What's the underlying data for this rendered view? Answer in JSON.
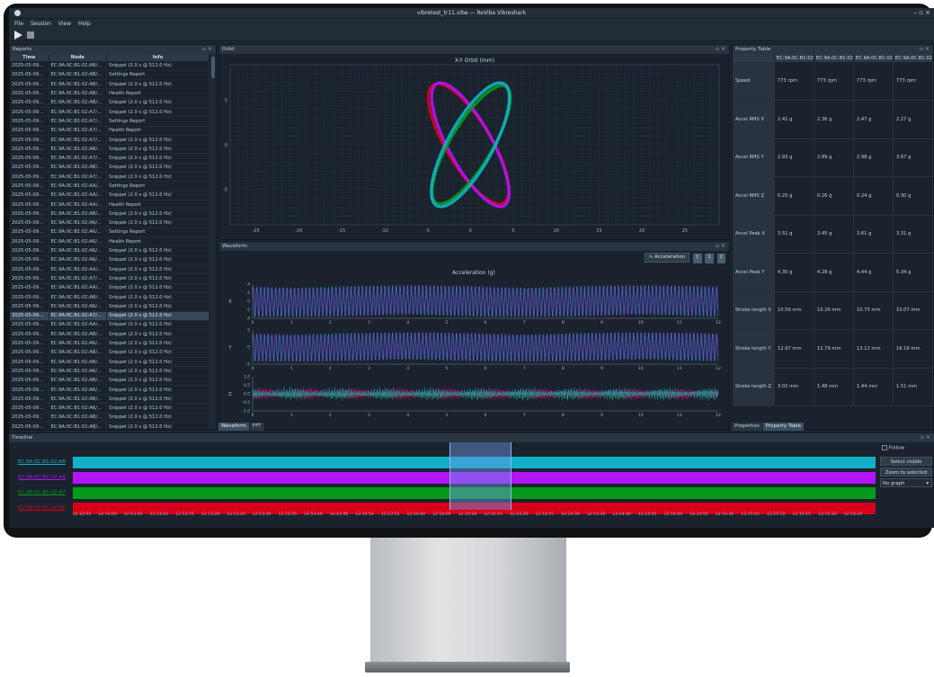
{
  "window": {
    "title": "vibretest_tr11.vibe — ReVibe Vibreshark",
    "controls": "– ▫ ×"
  },
  "menu": [
    "File",
    "Session",
    "View",
    "Help"
  ],
  "panels": {
    "reports": "Reports",
    "orbit": "Orbit",
    "waveform": "Waveform",
    "property_table": "Property Table",
    "timeline": "Timeline",
    "float_close": "▫ ×"
  },
  "reports": {
    "columns": [
      "Time",
      "Node",
      "Info"
    ],
    "rows": [
      [
        "2025-05-09...",
        "EC:9A:0C:B1:02:AB/...",
        "Snippet (2.0 s @ 512.0 Hz)"
      ],
      [
        "2025-05-09...",
        "EC:9A:0C:B1:02:AB/...",
        "Settings Report"
      ],
      [
        "2025-05-09...",
        "EC:9A:0C:B1:02:AB/...",
        "Snippet (2.0 s @ 512.0 Hz)"
      ],
      [
        "2025-05-09...",
        "EC:9A:0C:B1:02:AB/...",
        "Health Report"
      ],
      [
        "2025-05-09...",
        "EC:9A:0C:B1:02:AB/...",
        "Snippet (2.0 s @ 512.0 Hz)"
      ],
      [
        "2025-05-09...",
        "EC:9A:0C:B1:02:A7/...",
        "Snippet (2.0 s @ 512.0 Hz)"
      ],
      [
        "2025-05-09...",
        "EC:9A:0C:B1:02:A7/...",
        "Settings Report"
      ],
      [
        "2025-05-09...",
        "EC:9A:0C:B1:02:A7/...",
        "Health Report"
      ],
      [
        "2025-05-09...",
        "EC:9A:0C:B1:02:A7/...",
        "Snippet (2.0 s @ 512.0 Hz)"
      ],
      [
        "2025-05-09...",
        "EC:9A:0C:B1:02:AB/...",
        "Snippet (2.0 s @ 512.0 Hz)"
      ],
      [
        "2025-05-09...",
        "EC:9A:0C:B1:02:A7/...",
        "Snippet (2.0 s @ 512.0 Hz)"
      ],
      [
        "2025-05-09...",
        "EC:9A:0C:B1:02:AB/...",
        "Snippet (2.0 s @ 512.0 Hz)"
      ],
      [
        "2025-05-09...",
        "EC:9A:0C:B1:02:A7/...",
        "Snippet (2.0 s @ 512.0 Hz)"
      ],
      [
        "2025-05-09...",
        "EC:9A:0C:B1:02:AA/...",
        "Settings Report"
      ],
      [
        "2025-05-09...",
        "EC:9A:0C:B1:02:AA/...",
        "Snippet (2.0 s @ 512.0 Hz)"
      ],
      [
        "2025-05-09...",
        "EC:9A:0C:B1:02:AA/...",
        "Health Report"
      ],
      [
        "2025-05-09...",
        "EC:9A:0C:B1:02:AB/...",
        "Snippet (2.0 s @ 512.0 Hz)"
      ],
      [
        "2025-05-09...",
        "EC:9A:0C:B1:02:A6/...",
        "Snippet (2.0 s @ 512.0 Hz)"
      ],
      [
        "2025-05-09...",
        "EC:9A:0C:B1:02:A6/...",
        "Settings Report"
      ],
      [
        "2025-05-09...",
        "EC:9A:0C:B1:02:A6/...",
        "Health Report"
      ],
      [
        "2025-05-09...",
        "EC:9A:0C:B1:02:A6/...",
        "Snippet (2.0 s @ 512.0 Hz)"
      ],
      [
        "2025-05-09...",
        "EC:9A:0C:B1:02:A6/...",
        "Snippet (2.0 s @ 512.0 Hz)"
      ],
      [
        "2025-05-09...",
        "EC:9A:0C:B1:02:AA/...",
        "Snippet (2.0 s @ 512.0 Hz)"
      ],
      [
        "2025-05-09...",
        "EC:9A:0C:B1:02:A7/...",
        "Snippet (2.0 s @ 512.0 Hz)"
      ],
      [
        "2025-05-09...",
        "EC:9A:0C:B1:02:AA/...",
        "Snippet (2.0 s @ 512.0 Hz)"
      ],
      [
        "2025-05-09...",
        "EC:9A:0C:B1:02:AB/...",
        "Snippet (2.0 s @ 512.0 Hz)"
      ],
      [
        "2025-05-09...",
        "EC:9A:0C:B1:02:A6/...",
        "Snippet (2.0 s @ 512.0 Hz)"
      ],
      [
        "2025-05-09...",
        "EC:9A:0C:B1:02:A7/...",
        "Snippet (2.0 s @ 512.0 Hz)"
      ],
      [
        "2025-05-09...",
        "EC:9A:0C:B1:02:AA/...",
        "Snippet (2.0 s @ 512.0 Hz)"
      ],
      [
        "2025-05-09...",
        "EC:9A:0C:B1:02:AB/...",
        "Snippet (2.0 s @ 512.0 Hz)"
      ],
      [
        "2025-05-09...",
        "EC:9A:0C:B1:02:A6/...",
        "Snippet (2.0 s @ 512.0 Hz)"
      ],
      [
        "2025-05-09...",
        "EC:9A:0C:B1:02:AB/...",
        "Snippet (2.0 s @ 512.0 Hz)"
      ],
      [
        "2025-05-09...",
        "EC:9A:0C:B1:02:AB/...",
        "Snippet (2.0 s @ 512.0 Hz)"
      ],
      [
        "2025-05-09...",
        "EC:9A:0C:B1:02:A6/...",
        "Snippet (2.0 s @ 512.0 Hz)"
      ],
      [
        "2025-05-09...",
        "EC:9A:0C:B1:02:AB/...",
        "Snippet (2.0 s @ 512.0 Hz)"
      ],
      [
        "2025-05-09...",
        "EC:9A:0C:B1:02:A6/...",
        "Snippet (2.0 s @ 512.0 Hz)"
      ],
      [
        "2025-05-09...",
        "EC:9A:0C:B1:02:AB/...",
        "Snippet (2.0 s @ 512.0 Hz)"
      ],
      [
        "2025-05-09...",
        "EC:9A:0C:B1:02:A6/...",
        "Snippet (2.0 s @ 512.0 Hz)"
      ],
      [
        "2025-05-09...",
        "EC:9A:0C:B1:02:AB/...",
        "Snippet (2.0 s @ 512.0 Hz)"
      ],
      [
        "2025-05-09...",
        "EC:9A:0C:B1:02:AB/...",
        "Snippet (2.0 s @ 512.0 Hz)"
      ]
    ],
    "selected_row": 27
  },
  "orbit_plot": {
    "title": "X-Y Orbit (mm)",
    "x_ticks": [
      "-25",
      "-20",
      "-15",
      "-10",
      "-5",
      "0",
      "5",
      "10",
      "15",
      "20",
      "25"
    ],
    "y_ticks": [
      "5",
      "0",
      "-5"
    ]
  },
  "waveform_toolbar": {
    "mode": "Acceleration",
    "buttons": [
      "1",
      "1",
      "2"
    ]
  },
  "waveform_plot": {
    "title": "Acceleration (g)",
    "axes": [
      "X",
      "Y",
      "Z"
    ],
    "x_ticks": [
      "0",
      "1",
      "2",
      "3",
      "4",
      "5",
      "6",
      "7",
      "8",
      "9",
      "10",
      "11",
      "12"
    ],
    "x_y_ticks": [
      "4",
      "2",
      "0",
      "-2",
      "-4"
    ],
    "y_y_ticks": [
      "5",
      "0",
      "-5"
    ],
    "z_y_ticks": [
      "1.0",
      "0.5",
      "0.0",
      "-0.5",
      "-1.0"
    ]
  },
  "center_tabs": [
    "Waveform",
    "FFT"
  ],
  "property": {
    "columns": [
      "",
      "EC:9A:0C:B1:02:A7/(s",
      "EC:9A:0C:B1:02:AB/(s",
      "EC:9A:0C:B1:02:A6/(s",
      "EC:9A:0C:B1:02:AA/(s"
    ],
    "rows": [
      [
        "Speed",
        "773 rpm",
        "773 rpm",
        "773 rpm",
        "773 rpm"
      ],
      [
        "Accel RMS X",
        "2.41 g",
        "2.36 g",
        "2.47 g",
        "2.27 g"
      ],
      [
        "Accel RMS Y",
        "2.93 g",
        "2.89 g",
        "2.98 g",
        "3.67 g"
      ],
      [
        "Accel RMS Z",
        "0.25 g",
        "0.26 g",
        "0.24 g",
        "0.30 g"
      ],
      [
        "Accel Peak X",
        "3.51 g",
        "3.45 g",
        "3.61 g",
        "3.31 g"
      ],
      [
        "Accel Peak Y",
        "4.35 g",
        "4.28 g",
        "4.44 g",
        "5.34 g"
      ],
      [
        "Stroke length X",
        "10.56 mm",
        "10.26 mm",
        "10.75 mm",
        "10.07 mm"
      ],
      [
        "Stroke length Y",
        "12.97 mm",
        "12.79 mm",
        "13.12 mm",
        "16.16 mm"
      ],
      [
        "Stroke length Z",
        "3.02 mm",
        "1.48 mm",
        "1.44 mm",
        "1.51 mm"
      ]
    ]
  },
  "right_tabs": [
    "Properties",
    "Property Table"
  ],
  "timeline": {
    "nodes": [
      {
        "label": "EC:9A:0C:B1:02:AB",
        "color": "#12b0c8"
      },
      {
        "label": "EC:9A:0C:B1:02:AA",
        "color": "#b114f5"
      },
      {
        "label": "EC:9A:0C:B1:02:A7",
        "color": "#079a1a"
      },
      {
        "label": "EC:9A:0C:B1:02:A6",
        "color": "#d6001a"
      }
    ],
    "ticks": [
      "12:12:55",
      "12:13:00",
      "12:13:05",
      "12:13:10",
      "12:13:15",
      "12:13:20",
      "12:13:25",
      "12:13:30",
      "12:13:35",
      "12:13:40",
      "12:13:45",
      "12:13:50",
      "12:13:55",
      "12:14:00",
      "12:14:05",
      "12:14:10",
      "12:14:15",
      "12:14:20",
      "12:14:25",
      "12:14:30",
      "12:14:35",
      "12:14:40",
      "12:14:45",
      "12:14:50",
      "12:14:55",
      "12:15:00",
      "12:15:05",
      "12:15:10",
      "12:15:15",
      "12:15:20",
      "12:15:25"
    ],
    "follow_label": "Follow",
    "select_visible": "Select visible",
    "zoom_selected": "Zoom to selected",
    "graph_select": "No graph"
  },
  "colors": {
    "cyan": "#12b0c8",
    "magenta": "#b114f5",
    "green": "#079a1a",
    "red": "#d6001a"
  }
}
